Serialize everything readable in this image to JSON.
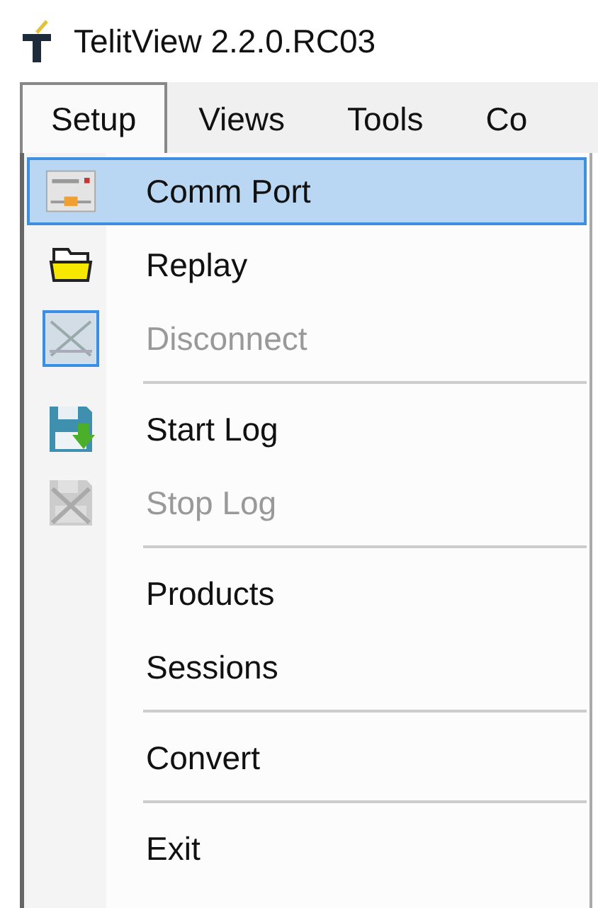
{
  "window": {
    "title": "TelitView 2.2.0.RC03"
  },
  "menubar": [
    {
      "label": "Setup",
      "selected": true
    },
    {
      "label": "Views",
      "selected": false
    },
    {
      "label": "Tools",
      "selected": false
    },
    {
      "label": "Co",
      "selected": false
    }
  ],
  "menu": [
    {
      "kind": "port",
      "label": "Comm Port",
      "selected": true,
      "disabled": false,
      "checked": false
    },
    {
      "kind": "folder",
      "label": "Replay",
      "selected": false,
      "disabled": false,
      "checked": false
    },
    {
      "kind": "disconnect",
      "label": "Disconnect",
      "selected": false,
      "disabled": true,
      "checked": true
    },
    {
      "kind": "separator"
    },
    {
      "kind": "save",
      "label": "Start Log",
      "selected": false,
      "disabled": false,
      "checked": false
    },
    {
      "kind": "stopsave",
      "label": "Stop Log",
      "selected": false,
      "disabled": true,
      "checked": false
    },
    {
      "kind": "separator"
    },
    {
      "kind": "plain",
      "label": "Products",
      "selected": false,
      "disabled": false,
      "checked": false
    },
    {
      "kind": "plain",
      "label": "Sessions",
      "selected": false,
      "disabled": false,
      "checked": false
    },
    {
      "kind": "separator"
    },
    {
      "kind": "plain",
      "label": "Convert",
      "selected": false,
      "disabled": false,
      "checked": false
    },
    {
      "kind": "separator"
    },
    {
      "kind": "plain",
      "label": "Exit",
      "selected": false,
      "disabled": false,
      "checked": false
    }
  ]
}
